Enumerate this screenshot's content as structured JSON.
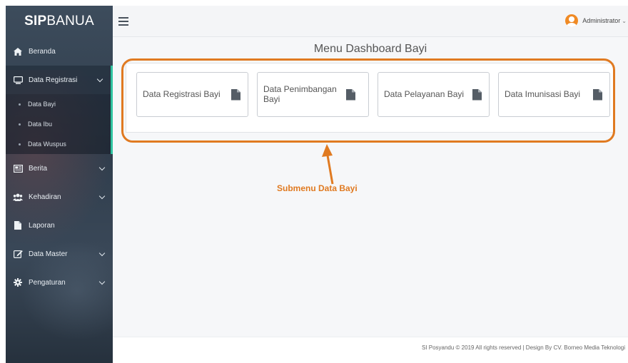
{
  "brand": {
    "bold": "SIP",
    "rest": "BANUA"
  },
  "user": {
    "name": "Administrator",
    "caret": "⌄"
  },
  "sidebar": {
    "items": [
      {
        "label": "Beranda",
        "icon": "home-icon"
      },
      {
        "label": "Data Registrasi",
        "icon": "monitor-icon",
        "active": true,
        "children": [
          "Data Bayi",
          "Data Ibu",
          "Data Wuspus"
        ]
      },
      {
        "label": "Berita",
        "icon": "newspaper-icon"
      },
      {
        "label": "Kehadiran",
        "icon": "users-icon"
      },
      {
        "label": "Laporan",
        "icon": "file-icon"
      },
      {
        "label": "Data Master",
        "icon": "edit-icon"
      },
      {
        "label": "Pengaturan",
        "icon": "gear-icon"
      }
    ]
  },
  "main": {
    "title": "Menu Dashboard Bayi",
    "cards": [
      {
        "label": "Data Registrasi Bayi"
      },
      {
        "label": "Data Penimbangan Bayi"
      },
      {
        "label": "Data Pelayanan Bayi"
      },
      {
        "label": "Data Imunisasi Bayi"
      }
    ]
  },
  "annotation": {
    "text": "Submenu Data Bayi",
    "color": "#e07a21"
  },
  "footer": {
    "text": "SI Posyandu © 2019 All rights reserved | Design By CV. Borneo Media Teknologi"
  },
  "colors": {
    "accent": "#2fc3a0",
    "highlight": "#e07a21"
  }
}
